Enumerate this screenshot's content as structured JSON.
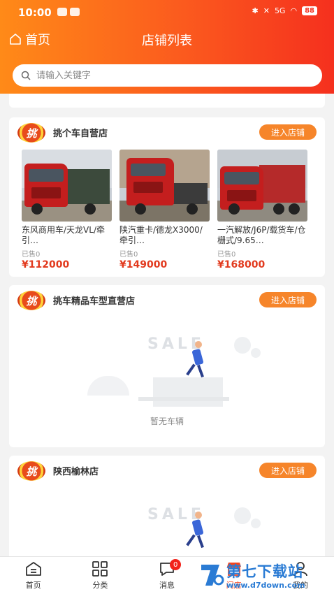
{
  "status_bar": {
    "time": "10:00",
    "signal": "5G",
    "battery": "88"
  },
  "nav": {
    "back_label": "首页",
    "title": "店铺列表"
  },
  "search": {
    "placeholder": "请输入关键字"
  },
  "stores": [
    {
      "logo_text": "挑",
      "name": "挑个车自营店",
      "enter_label": "进入店铺",
      "products": [
        {
          "title": "东风商用车/天龙VL/牵引…",
          "sold": "已售0",
          "price": "¥112000"
        },
        {
          "title": "陕汽重卡/德龙X3000/牵引…",
          "sold": "已售0",
          "price": "¥149000"
        },
        {
          "title": "一汽解放/J6P/载货车/仓栅式/9.65…",
          "sold": "已售0",
          "price": "¥168000"
        }
      ]
    },
    {
      "logo_text": "挑",
      "name": "挑车精品车型直营店",
      "enter_label": "进入店铺",
      "empty_art_text": "SALE",
      "empty_text": "暂无车辆"
    },
    {
      "logo_text": "挑",
      "name": "陕西榆林店",
      "enter_label": "进入店铺",
      "empty_art_text": "SALE"
    }
  ],
  "tab_bar": {
    "tabs": [
      {
        "label": "首页",
        "icon": "home-icon"
      },
      {
        "label": "分类",
        "icon": "grid-icon"
      },
      {
        "label": "消息",
        "icon": "message-icon",
        "badge": "0"
      },
      {
        "label": "门店",
        "icon": "store-icon",
        "active": true
      },
      {
        "label": "我的",
        "icon": "user-icon"
      }
    ]
  },
  "watermark": {
    "title": "第七下载站",
    "url": "www.d7down.com"
  },
  "colors": {
    "accent": "#f6852a",
    "price": "#e23a1e",
    "header_start": "#ff8a18",
    "header_end": "#f5301e"
  }
}
